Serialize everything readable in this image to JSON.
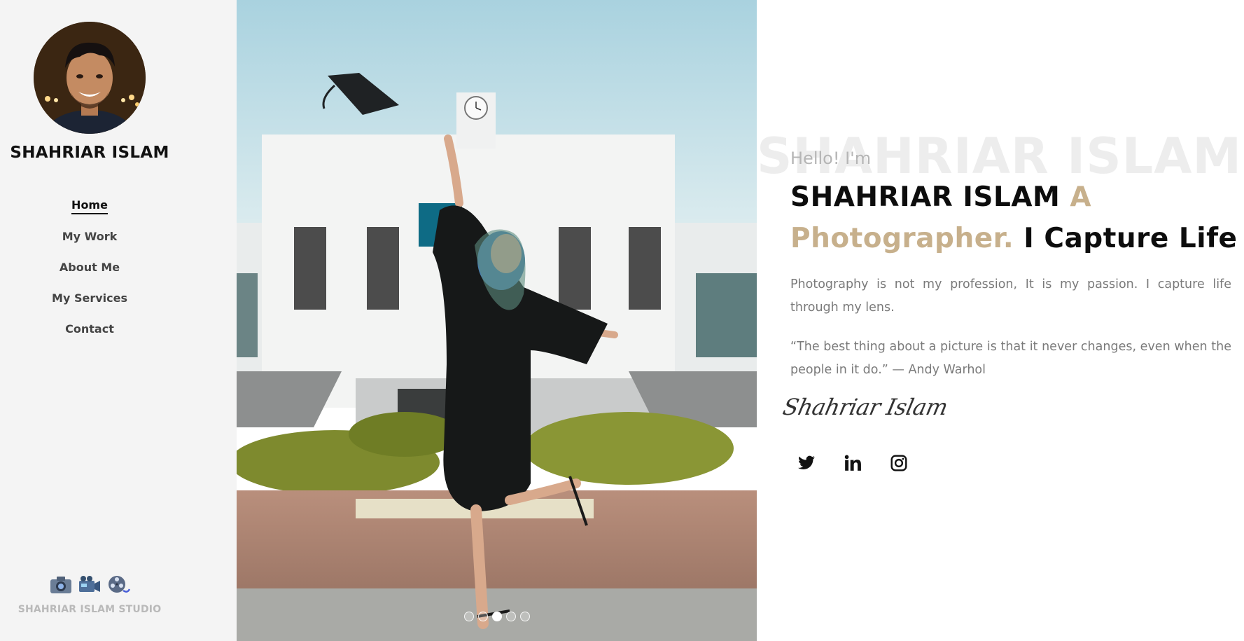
{
  "sidebar": {
    "name": "SHAHRIAR ISLAM",
    "nav": [
      {
        "label": "Home",
        "active": true
      },
      {
        "label": "My Work",
        "active": false
      },
      {
        "label": "About Me",
        "active": false
      },
      {
        "label": "My Services",
        "active": false
      },
      {
        "label": "Contact",
        "active": false
      }
    ],
    "studio_icons": [
      "camera-icon",
      "video-camera-icon",
      "film-reel-icon"
    ],
    "studio_name": "SHAHRIAR ISLAM STUDIO"
  },
  "slider": {
    "image_alt": "graduate-jumping-photo",
    "slide_count": 5,
    "active_slide": 3
  },
  "hero": {
    "background_name": "SHAHRIAR ISLAM",
    "greeting": "Hello! I'm",
    "name": "SHAHRIAR ISLAM",
    "accent_text": "A Photographer.",
    "tagline": "I Capture Life",
    "paragraph_1": "Photography is not my profession, It is my passion. I capture life through my lens.",
    "paragraph_2": "“The best thing about a picture is that it never changes, even when the people in it do.” — Andy Warhol",
    "signature": "Shahriar Islam",
    "social": [
      "twitter-icon",
      "linkedin-icon",
      "instagram-icon"
    ]
  },
  "colors": {
    "accent": "#c7b08c",
    "sidebar_bg": "#f4f4f4",
    "text_muted": "#7a7a7a"
  }
}
